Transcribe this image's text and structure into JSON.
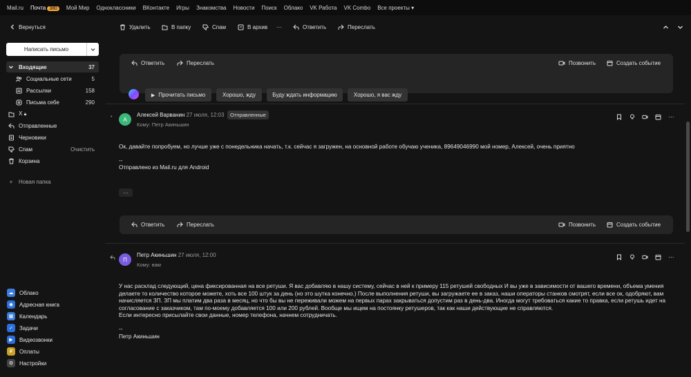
{
  "topnav": {
    "links": [
      "Mail.ru",
      "Почта",
      "Мой Мир",
      "Одноклассники",
      "ВКонтакте",
      "Игры",
      "Знакомства",
      "Новости",
      "Поиск",
      "Облако",
      "VK Работа",
      "VK Combo",
      "Все проекты"
    ],
    "mail_badge": "380"
  },
  "toolbar": {
    "back": "Вернуться",
    "delete": "Удалить",
    "to_folder": "В папку",
    "spam": "Спам",
    "archive": "В архив",
    "more": "···",
    "reply": "Ответить",
    "forward": "Переслать"
  },
  "sidebar": {
    "compose": "Написать письмо",
    "folders": [
      {
        "name": "Входящие",
        "count": "37"
      },
      {
        "name": "Социальные сети",
        "count": "5"
      },
      {
        "name": "Рассылки",
        "count": "158"
      },
      {
        "name": "Письма себе",
        "count": "290"
      },
      {
        "name": "X",
        "count": ""
      },
      {
        "name": "Отправленные",
        "count": ""
      },
      {
        "name": "Черновики",
        "count": ""
      },
      {
        "name": "Спам",
        "count": "Очистить"
      },
      {
        "name": "Корзина",
        "count": ""
      }
    ],
    "new_folder": "Новая папка",
    "apps": [
      {
        "name": "Облако",
        "color": "#3b7ddd"
      },
      {
        "name": "Адресная книга",
        "color": "#2a6fdb"
      },
      {
        "name": "Календарь",
        "color": "#3b7ddd"
      },
      {
        "name": "Задачи",
        "color": "#2a6fdb"
      },
      {
        "name": "Видеозвонки",
        "color": "#2a6fdb"
      },
      {
        "name": "Оплаты",
        "color": "#c9a227"
      },
      {
        "name": "Настройки",
        "color": "#444444"
      }
    ]
  },
  "panel_top": {
    "reply": "Ответить",
    "forward": "Переслать",
    "call": "Позвонить",
    "event": "Создать событие",
    "read_letter": "Прочитать письмо",
    "quick_replies": [
      "Хорошо, жду",
      "Буду ждать информацию",
      "Хорошо, я вас жду"
    ]
  },
  "message1": {
    "avatar": "А",
    "avatar_color": "#3cb878",
    "sender": "Алексей Варванин",
    "date": "27 июля, 12:03",
    "tag": "Отправленные",
    "to": "Кому: Петр Акиньшин",
    "body": "Ок, давайте попробуем, но лучше уже с понедельника начать, т.к. сейчас я загружен, на основной работе обучаю ученика, 89649046990 мой номер, Алексей, очень приятно",
    "sig_dash": "--",
    "sig": "Отправлено из Mail.ru для Android",
    "more": "···"
  },
  "panel_mid": {
    "reply": "Ответить",
    "forward": "Переслать",
    "call": "Позвонить",
    "event": "Создать событие"
  },
  "message2": {
    "avatar": "П",
    "avatar_color": "#7a5ce0",
    "sender": "Петр Акиньшин",
    "date": "27 июля, 12:00",
    "to": "Кому: вам",
    "body1": "У нас расклад следующий, цена фиксированная на все ретуши.  Я вас добавляю в нашу систему, сейчас в ней к примеру 115 ретушей свободных  И вы уже в зависимости от вашего времени, объема умения делаете то количество которое можете, хоть все 100 штук за день (но это шутка конечно.) После выполнения ретуши, вы загружаете ее в заказ, наши операторы станков смотрят, если все ок, одобряют, вам начисляется ЗП. ЗП мы платим два раза в месяц, но что бы вы не переживали можем на первых парах закрываться допустим раз в день-два. Иногда могут требоваться какие то правка, если ретушь идет на согласование с заказчиком, там по-моему добавляется 100 или 200 рублей. Вообще мы ищем на постоянку ретушеров, так как наши действующие не справляются.",
    "body2": "Если интересно присылайте свои данные, номер телефона, начнем сотрудничать.",
    "sig_dash": "--",
    "sig": "Петр Акиньшин"
  }
}
